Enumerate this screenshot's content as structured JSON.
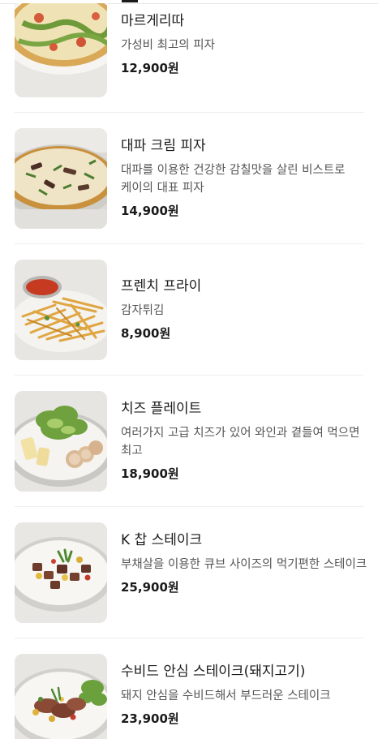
{
  "menu": {
    "items": [
      {
        "name": "마르게리따",
        "description": "가성비 최고의 피자",
        "price": "12,900원",
        "image_icon": "margherita-pizza"
      },
      {
        "name": "대파 크림 피자",
        "description": "대파를 이용한 건강한 감칠맛을 살린 비스트로 케이의 대표 피자",
        "price": "14,900원",
        "image_icon": "green-onion-cream-pizza"
      },
      {
        "name": "프렌치 프라이",
        "description": "감자튀김",
        "price": "8,900원",
        "image_icon": "french-fries"
      },
      {
        "name": "치즈 플레이트",
        "description": "여러가지 고급 치즈가 있어 와인과 곁들여 먹으면 최고",
        "price": "18,900원",
        "image_icon": "cheese-plate"
      },
      {
        "name": "K 찹 스테이크",
        "description": "부채살을 이용한 큐브 사이즈의 먹기편한 스테이크",
        "price": "25,900원",
        "image_icon": "chop-steak"
      },
      {
        "name": "수비드 안심 스테이크(돼지고기)",
        "description": "돼지 안심을 수비드해서 부드러운 스테이크",
        "price": "23,900원",
        "image_icon": "sous-vide-pork-steak"
      }
    ]
  }
}
